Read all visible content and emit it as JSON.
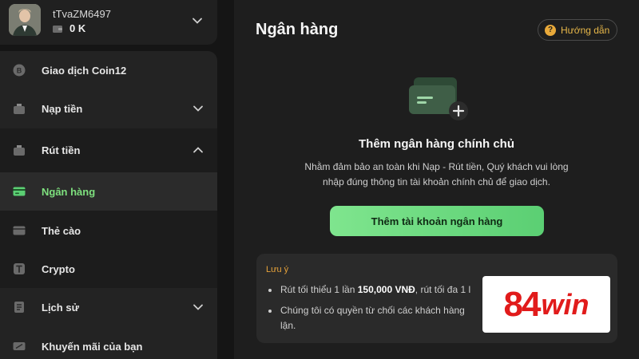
{
  "user": {
    "username": "tTvaZM6497",
    "balance": "0 K"
  },
  "menu": {
    "items": [
      {
        "label": "Giao dịch Coin12"
      },
      {
        "label": "Nạp tiền"
      },
      {
        "label": "Rút tiền"
      },
      {
        "label": "Ngân hàng"
      },
      {
        "label": "Thẻ cào"
      },
      {
        "label": "Crypto"
      },
      {
        "label": "Lịch sử"
      },
      {
        "label": "Khuyến mãi của bạn"
      }
    ]
  },
  "main": {
    "title": "Ngân hàng",
    "guide_label": "Hướng dẫn",
    "empty_title": "Thêm ngân hàng chính chủ",
    "empty_desc_line1": "Nhằm đảm bảo an toàn khi Nạp - Rút tiền, Quý khách vui lòng",
    "empty_desc_line2": "nhập đúng thông tin tài khoản chính chủ để giao dịch.",
    "add_button": "Thêm tài khoản ngân hàng",
    "note": {
      "title": "Lưu ý",
      "line1_pre": "Rút tối thiểu 1 lần ",
      "line1_amount": "150,000 VNĐ",
      "line1_post": ", rút tối đa 1 l",
      "line2": "Chúng tôi có quyền từ chối các khách hàng",
      "line2b": "lận."
    }
  },
  "brand": {
    "number": "84",
    "word": "win"
  },
  "colors": {
    "accent_green": "#7ee07e",
    "warning_orange": "#e8a33a",
    "brand_red": "#e11b1b"
  },
  "icons": [
    "coin-icon",
    "deposit-icon",
    "withdraw-icon",
    "bank-card-icon",
    "scratch-card-icon",
    "crypto-icon",
    "history-icon",
    "promo-icon",
    "chevron-down-icon",
    "chevron-up-icon",
    "help-icon",
    "wallet-icon"
  ]
}
